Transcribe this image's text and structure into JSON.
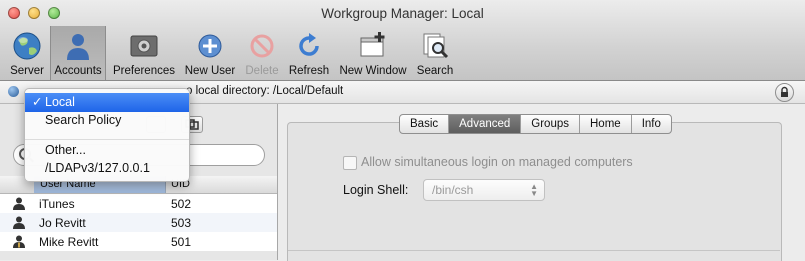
{
  "window": {
    "title": "Workgroup Manager: Local"
  },
  "toolbar": {
    "server": "Server",
    "accounts": "Accounts",
    "preferences": "Preferences",
    "new_user": "New User",
    "delete": "Delete",
    "refresh": "Refresh",
    "new_window": "New Window",
    "search": "Search"
  },
  "pathbar": {
    "text": "o local directory: /Local/Default"
  },
  "directory_menu": {
    "checkmark": "✓",
    "items": [
      "Local",
      "Search Policy",
      "Other...",
      "/LDAPv3/127.0.0.1"
    ]
  },
  "user_list": {
    "headers": {
      "name": "User Name",
      "uid": "UID"
    },
    "rows": [
      {
        "name": "iTunes",
        "uid": "502"
      },
      {
        "name": "Jo Revitt",
        "uid": "503"
      },
      {
        "name": "Mike Revitt",
        "uid": "501"
      }
    ]
  },
  "tabs": [
    "Basic",
    "Advanced",
    "Groups",
    "Home",
    "Info"
  ],
  "advanced": {
    "simultaneous_login": "Allow simultaneous login on managed computers",
    "login_shell_label": "Login Shell:",
    "login_shell_value": "/bin/csh"
  },
  "colors": {
    "selection": "#1e64e8",
    "tab_selected": "#6b6b6b"
  }
}
